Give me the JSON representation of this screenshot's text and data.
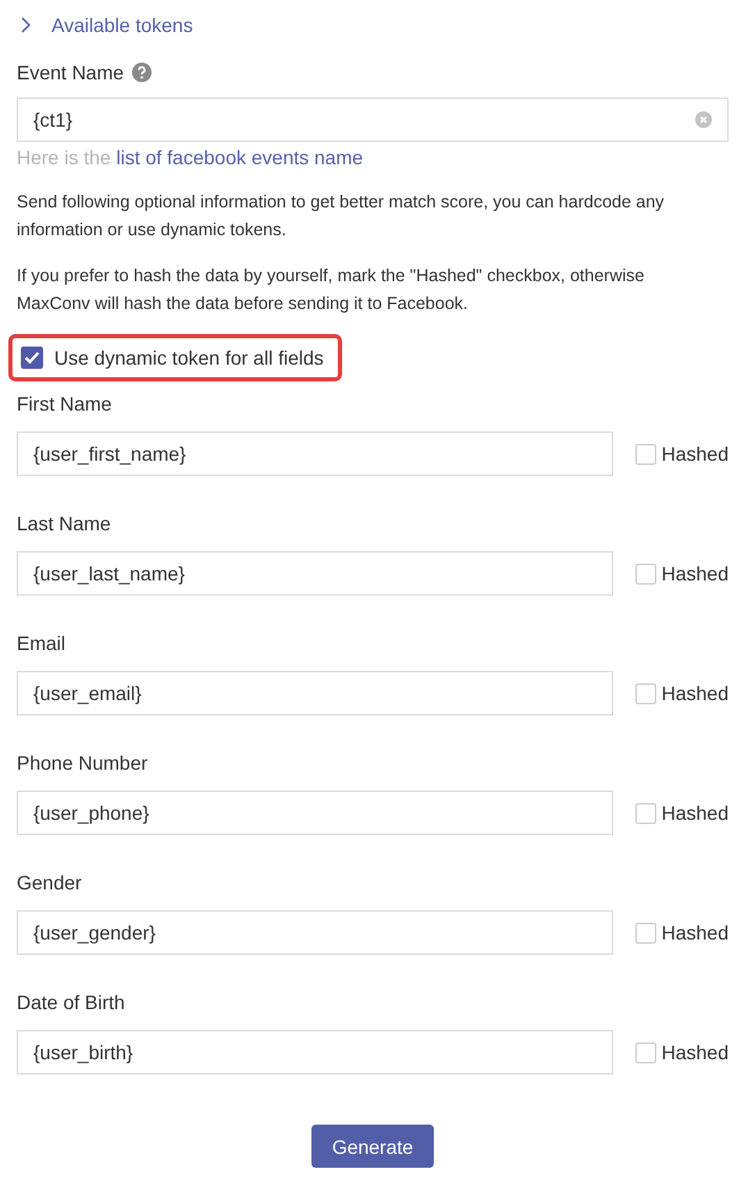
{
  "tokens_toggle": {
    "label": "Available tokens",
    "expanded": false
  },
  "event_name": {
    "label": "Event Name",
    "value": "{ct1}",
    "hint": "Here is the ",
    "hint_link": "list of facebook events name"
  },
  "paragraphs": [
    "Send following optional information to get better match score, you can hardcode any information or use dynamic tokens.",
    "If you prefer to hash the data by yourself, mark the \"Hashed\" checkbox, otherwise MaxConv will hash the data before sending it to Facebook."
  ],
  "dynamic_toggle": {
    "label": "Use dynamic token for all fields",
    "checked": true,
    "highlighted": true
  },
  "fields": [
    {
      "label": "First Name",
      "value": "{user_first_name}",
      "hashed_label": "Hashed",
      "hashed": false
    },
    {
      "label": "Last Name",
      "value": "{user_last_name}",
      "hashed_label": "Hashed",
      "hashed": false
    },
    {
      "label": "Email",
      "value": "{user_email}",
      "hashed_label": "Hashed",
      "hashed": false
    },
    {
      "label": "Phone Number",
      "value": "{user_phone}",
      "hashed_label": "Hashed",
      "hashed": false
    },
    {
      "label": "Gender",
      "value": "{user_gender}",
      "hashed_label": "Hashed",
      "hashed": false
    },
    {
      "label": "Date of Birth",
      "value": "{user_birth}",
      "hashed_label": "Hashed",
      "hashed": false
    }
  ],
  "button": "Generate"
}
